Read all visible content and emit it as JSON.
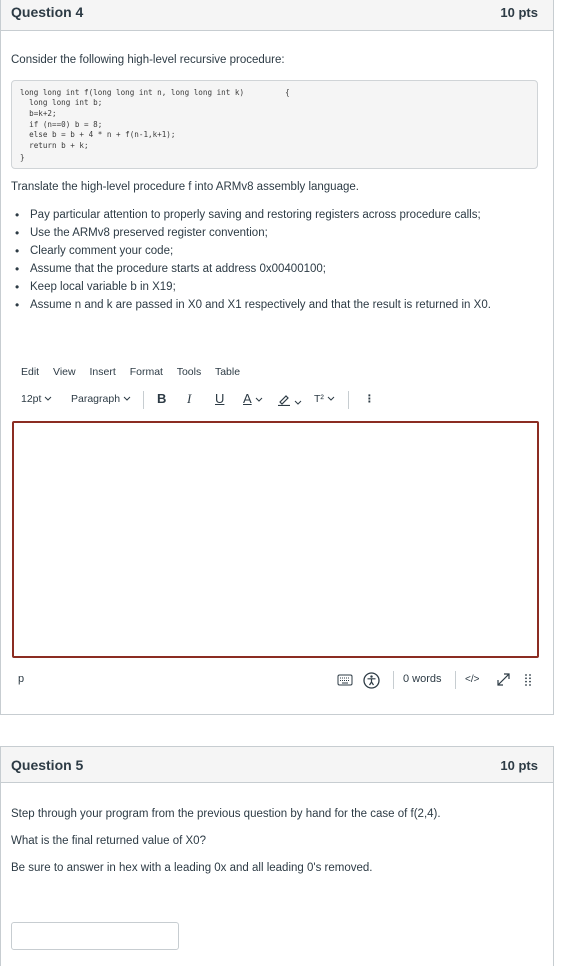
{
  "question4": {
    "title": "Question 4",
    "points": "10 pts",
    "intro": "Consider the following high-level recursive procedure:",
    "code_lines": [
      "long long int f(long long int n, long long int k)         {",
      "  long long int b;",
      "  b=k+2;",
      "  if (n==0) b = 8;",
      "  else b = b + 4 * n + f(n-1,k+1);",
      "  return b + k;",
      "}"
    ],
    "instruction": "Translate the high-level procedure f into ARMv8 assembly language.",
    "bullets": [
      "Pay particular attention to properly saving and restoring registers across procedure calls;",
      "Use the ARMv8 preserved register convention;",
      "Clearly comment your code;",
      "Assume that the procedure starts at address 0x00400100;",
      "Keep local variable b in X19;",
      "Assume n and k are passed in X0 and X1 respectively and that the result is returned in X0."
    ],
    "editor": {
      "menu": [
        "Edit",
        "View",
        "Insert",
        "Format",
        "Tools",
        "Table"
      ],
      "font_size": "12pt",
      "block_format": "Paragraph",
      "bold": "B",
      "italic": "I",
      "underline": "U",
      "text_color": "A",
      "superscript": "T²",
      "more": "⋮",
      "path": "p",
      "word_count": "0 words",
      "html_toggle": "</>",
      "accent_color": "#8b2c22"
    }
  },
  "question5": {
    "title": "Question 5",
    "points": "10 pts",
    "lines": [
      "Step through your program from the previous question by hand for the case of f(2,4).",
      "What is the final returned value of X0?",
      "Be sure to answer in hex with a leading 0x and all leading 0's removed."
    ],
    "answer_value": ""
  }
}
